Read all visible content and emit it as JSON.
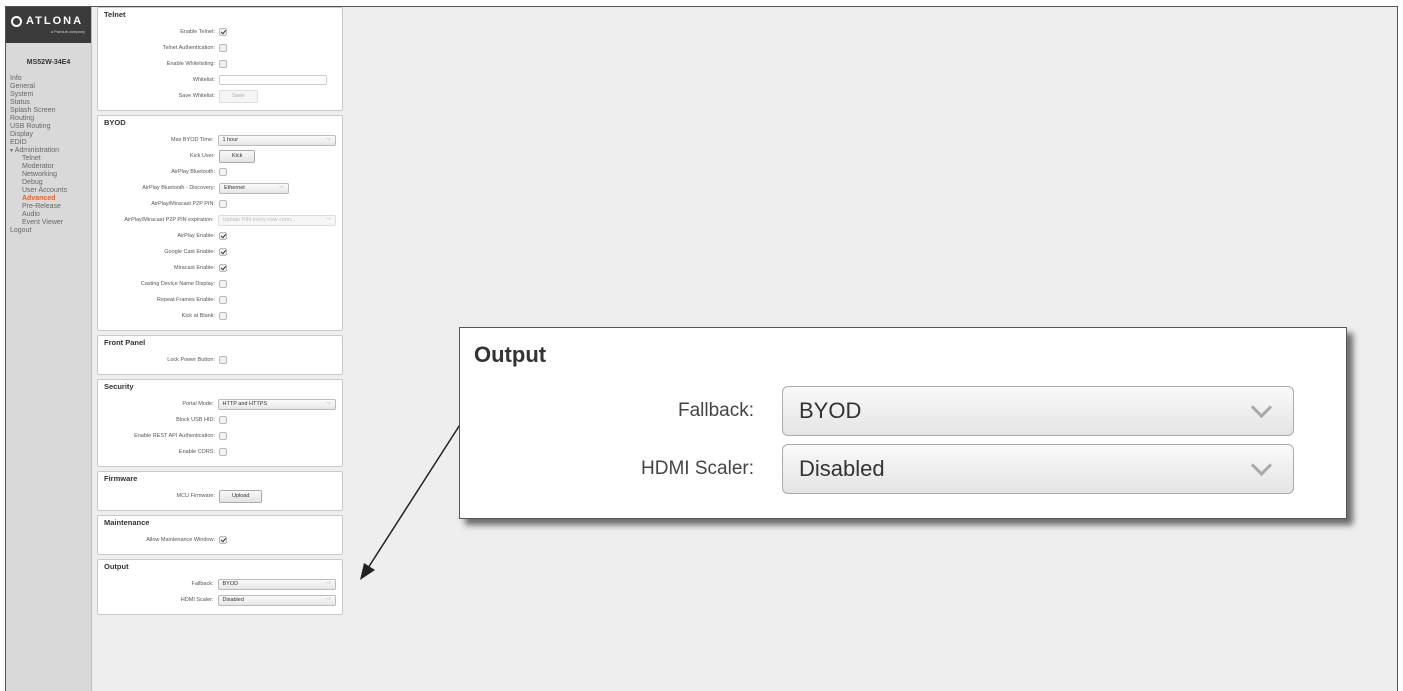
{
  "brand": {
    "logo": "ATLONA",
    "tagline": "a Panduit company"
  },
  "device_model": "MS52W-34E4",
  "nav": [
    {
      "label": "Info",
      "sub": false
    },
    {
      "label": "General",
      "sub": false
    },
    {
      "label": "System",
      "sub": false
    },
    {
      "label": "Status",
      "sub": false
    },
    {
      "label": "Splash Screen",
      "sub": false
    },
    {
      "label": "Routing",
      "sub": false
    },
    {
      "label": "USB Routing",
      "sub": false
    },
    {
      "label": "Display",
      "sub": false
    },
    {
      "label": "EDID",
      "sub": false
    },
    {
      "label": "Administration",
      "sub": false,
      "parent": true
    },
    {
      "label": "Telnet",
      "sub": true
    },
    {
      "label": "Moderator",
      "sub": true
    },
    {
      "label": "Networking",
      "sub": true
    },
    {
      "label": "Debug",
      "sub": true
    },
    {
      "label": "User Accounts",
      "sub": true
    },
    {
      "label": "Advanced",
      "sub": true,
      "active": true
    },
    {
      "label": "Pre-Release",
      "sub": true
    },
    {
      "label": "Audio",
      "sub": true
    },
    {
      "label": "Event Viewer",
      "sub": true
    },
    {
      "label": "Logout",
      "sub": false
    }
  ],
  "panels": {
    "telnet": {
      "title": "Telnet",
      "enable_telnet": {
        "label": "Enable Telnet:",
        "checked": true
      },
      "telnet_auth": {
        "label": "Telnet Authentication:",
        "checked": false
      },
      "enable_whitelisting": {
        "label": "Enable Whitelisting:",
        "checked": false
      },
      "whitelist": {
        "label": "Whitelist:",
        "value": ""
      },
      "save_whitelist": {
        "label": "Save Whitelist:",
        "button": "Save"
      }
    },
    "byod": {
      "title": "BYOD",
      "max_byod_time": {
        "label": "Max BYOD Time:",
        "value": "1 hour"
      },
      "kick_user": {
        "label": "Kick User:",
        "button": "Kick"
      },
      "airplay_bluetooth": {
        "label": "AirPlay Bluetooth:",
        "checked": false
      },
      "airplay_bt_discovery": {
        "label": "AirPlay Bluetooth - Discovery:",
        "value": "Ethernet"
      },
      "p2p_pin": {
        "label": "AirPlay/Miracast P2P PIN:",
        "checked": false
      },
      "p2p_pin_expiration": {
        "label": "AirPlay/Miracast P2P PIN expiration:",
        "value": "Update PIN every new conn..."
      },
      "airplay_enable": {
        "label": "AirPlay Enable:",
        "checked": true
      },
      "google_cast": {
        "label": "Google Cast Enable:",
        "checked": true
      },
      "miracast": {
        "label": "Miracast Enable:",
        "checked": true
      },
      "casting_name": {
        "label": "Casting Device Name Display:",
        "checked": false
      },
      "repeat_frames": {
        "label": "Repeat Frames Enable:",
        "checked": false
      },
      "kick_at_blank": {
        "label": "Kick at Blank:",
        "checked": false
      }
    },
    "front_panel": {
      "title": "Front Panel",
      "lock_power": {
        "label": "Lock Power Button:",
        "checked": false
      }
    },
    "security": {
      "title": "Security",
      "portal_mode": {
        "label": "Portal Mode:",
        "value": "HTTP and HTTPS"
      },
      "block_usb_hid": {
        "label": "Block USB HID:",
        "checked": false
      },
      "rest_api_auth": {
        "label": "Enable REST API Authentication:",
        "checked": false
      },
      "enable_cors": {
        "label": "Enable CORS:",
        "checked": false
      }
    },
    "firmware": {
      "title": "Firmware",
      "mcu_firmware": {
        "label": "MCU Firmware:",
        "button": "Upload"
      }
    },
    "maintenance": {
      "title": "Maintenance",
      "allow_window": {
        "label": "Allow Maintenance Window:",
        "checked": true
      }
    },
    "output": {
      "title": "Output",
      "fallback": {
        "label": "Fallback:",
        "value": "BYOD"
      },
      "hdmi_scaler": {
        "label": "HDMI Scaler:",
        "value": "Disabled"
      }
    }
  }
}
